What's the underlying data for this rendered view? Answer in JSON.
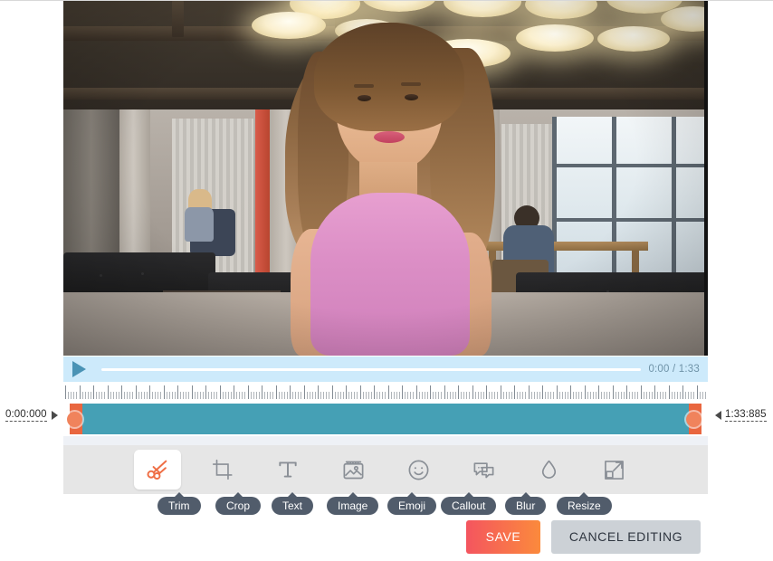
{
  "player": {
    "play_icon": "play-triangle-icon",
    "time_display": "0:00 / 1:33",
    "current_time": "0:00",
    "duration": "1:33"
  },
  "timeline": {
    "start_timestamp": "0:00:000",
    "end_timestamp": "1:33:885",
    "clip_color": "#45a0b5",
    "handle_color": "#e9663f"
  },
  "toolbar": {
    "tools": [
      {
        "id": "trim",
        "label": "Trim",
        "icon": "scissors-icon",
        "active": true
      },
      {
        "id": "crop",
        "label": "Crop",
        "icon": "crop-icon",
        "active": false
      },
      {
        "id": "text",
        "label": "Text",
        "icon": "text-t-icon",
        "active": false
      },
      {
        "id": "image",
        "label": "Image",
        "icon": "image-icon",
        "active": false
      },
      {
        "id": "emoji",
        "label": "Emoji",
        "icon": "smiley-icon",
        "active": false
      },
      {
        "id": "callout",
        "label": "Callout",
        "icon": "speech-bubble-icon",
        "active": false
      },
      {
        "id": "blur",
        "label": "Blur",
        "icon": "droplet-icon",
        "active": false
      },
      {
        "id": "resize",
        "label": "Resize",
        "icon": "resize-arrow-icon",
        "active": false
      }
    ],
    "active_color": "#ef6f46",
    "inactive_color": "#8a8f96",
    "tooltip_color": "#515c6b"
  },
  "actions": {
    "save_label": "SAVE",
    "cancel_label": "CANCEL EDITING",
    "save_color": "#f4555f",
    "cancel_color": "#ccd1d6"
  }
}
